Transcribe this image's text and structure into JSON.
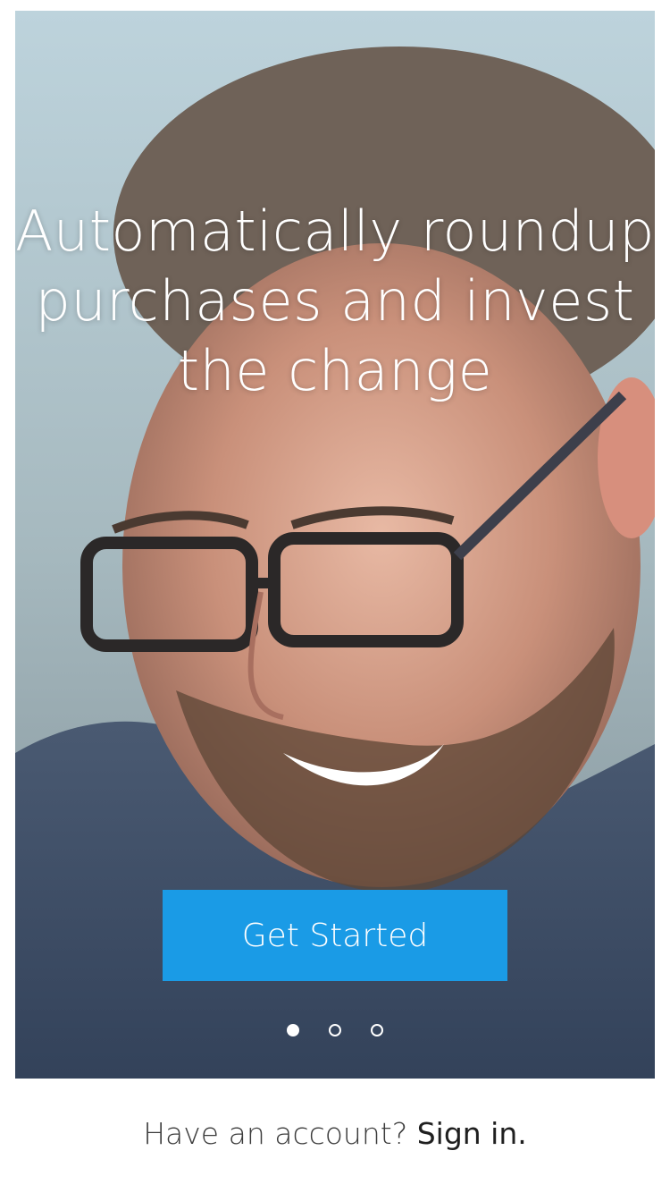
{
  "hero": {
    "headline": "Automatically roundup\npurchases and invest\nthe change",
    "cta_label": "Get Started"
  },
  "carousel": {
    "page_count": 3,
    "active_index": 0
  },
  "footer": {
    "prompt": "Have an account?",
    "link_label": "Sign in."
  },
  "colors": {
    "accent": "#1a9be6",
    "text_dark": "#3c3c3c"
  }
}
